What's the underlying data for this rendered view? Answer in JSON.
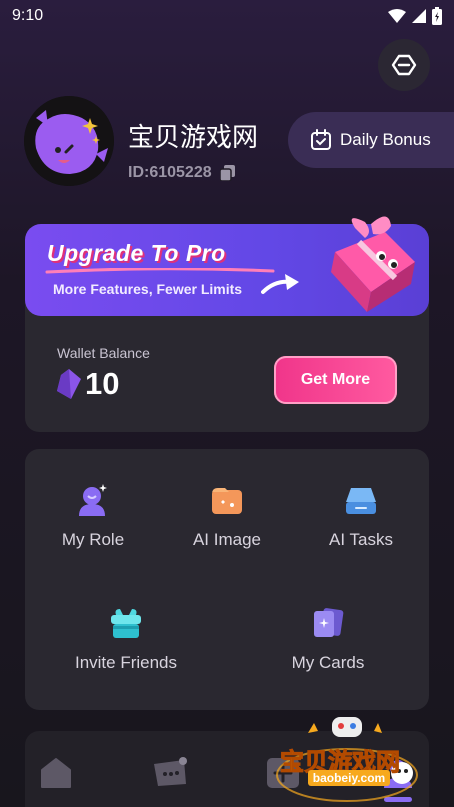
{
  "status_bar": {
    "time": "9:10"
  },
  "profile": {
    "username": "宝贝游戏网",
    "id_text": "ID:6105228"
  },
  "daily_bonus": {
    "label": "Daily Bonus"
  },
  "pro_banner": {
    "title": "Upgrade To Pro",
    "subtitle": "More Features, Fewer Limits"
  },
  "wallet": {
    "label": "Wallet Balance",
    "amount": "10",
    "get_more_label": "Get More"
  },
  "menu": {
    "items": [
      {
        "label": "My Role",
        "icon": "role-icon"
      },
      {
        "label": "AI Image",
        "icon": "image-icon"
      },
      {
        "label": "AI Tasks",
        "icon": "tasks-icon"
      },
      {
        "label": "Invite Friends",
        "icon": "gift-icon"
      },
      {
        "label": "My Cards",
        "icon": "cards-icon"
      }
    ]
  },
  "watermark": {
    "text": "宝贝游戏网",
    "url": "baobeiy.com"
  },
  "colors": {
    "accent": "#8a6cf3",
    "pink": "#f0358a",
    "card": "#2a2830"
  }
}
